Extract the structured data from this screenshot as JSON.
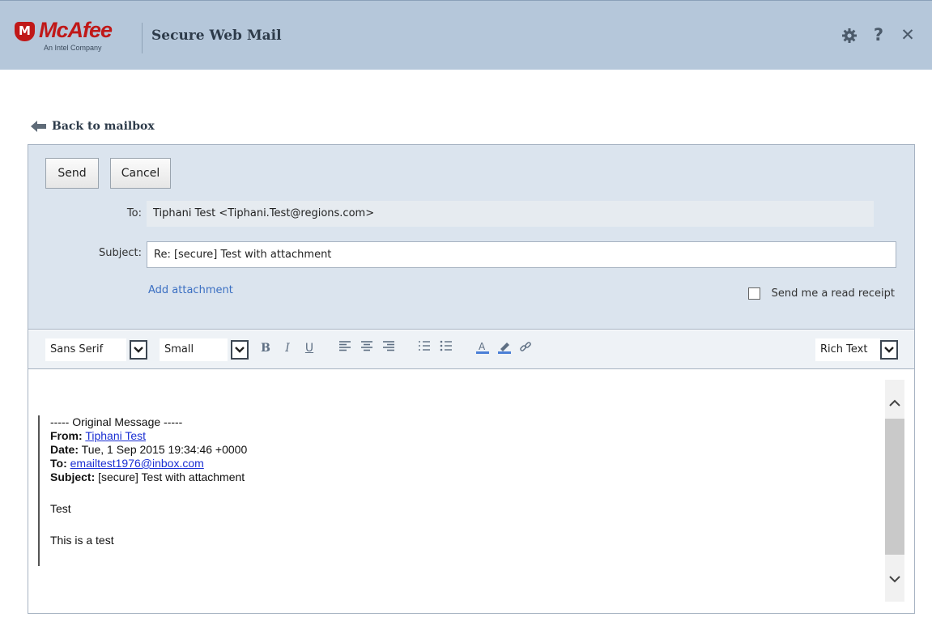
{
  "header": {
    "brand": "McAfee",
    "brand_tagline": "An Intel Company",
    "app_title": "Secure Web Mail",
    "icons": [
      "gear-icon",
      "help-icon",
      "close-icon"
    ],
    "help_glyph": "?",
    "close_glyph": "✕"
  },
  "nav": {
    "back_label": "Back to mailbox"
  },
  "compose": {
    "send_label": "Send",
    "cancel_label": "Cancel",
    "to_label": "To:",
    "to_value": "Tiphani Test <Tiphani.Test@regions.com>",
    "subject_label": "Subject:",
    "subject_value": "Re: [secure] Test with attachment",
    "add_attachment_label": "Add attachment",
    "read_receipt_label": "Send me a read receipt",
    "read_receipt_checked": false
  },
  "toolbar": {
    "font_family": "Sans Serif",
    "font_size": "Small",
    "format_mode": "Rich Text",
    "buttons": [
      "bold",
      "italic",
      "underline",
      "align-left",
      "align-center",
      "align-right",
      "numbered-list",
      "bullet-list",
      "text-color",
      "highlight-color",
      "link"
    ],
    "bold_glyph": "B",
    "italic_glyph": "I",
    "underline_glyph": "U",
    "text_color": "#4a7fd6"
  },
  "message": {
    "separator": "----- Original Message -----",
    "from_label": "From:",
    "from_value": "Tiphani Test",
    "date_label": "Date:",
    "date_value": "Tue, 1 Sep 2015 19:34:46 +0000",
    "to_label": "To:",
    "to_value": "emailtest1976@inbox.com",
    "subject_label": "Subject:",
    "subject_value": "[secure] Test with attachment",
    "body_lines": [
      "Test",
      "This is a test"
    ]
  },
  "colors": {
    "header_bg": "#b5c7da",
    "panel_bg": "#dbe4ee",
    "link": "#3b6fc2",
    "brand_red": "#c01818"
  }
}
